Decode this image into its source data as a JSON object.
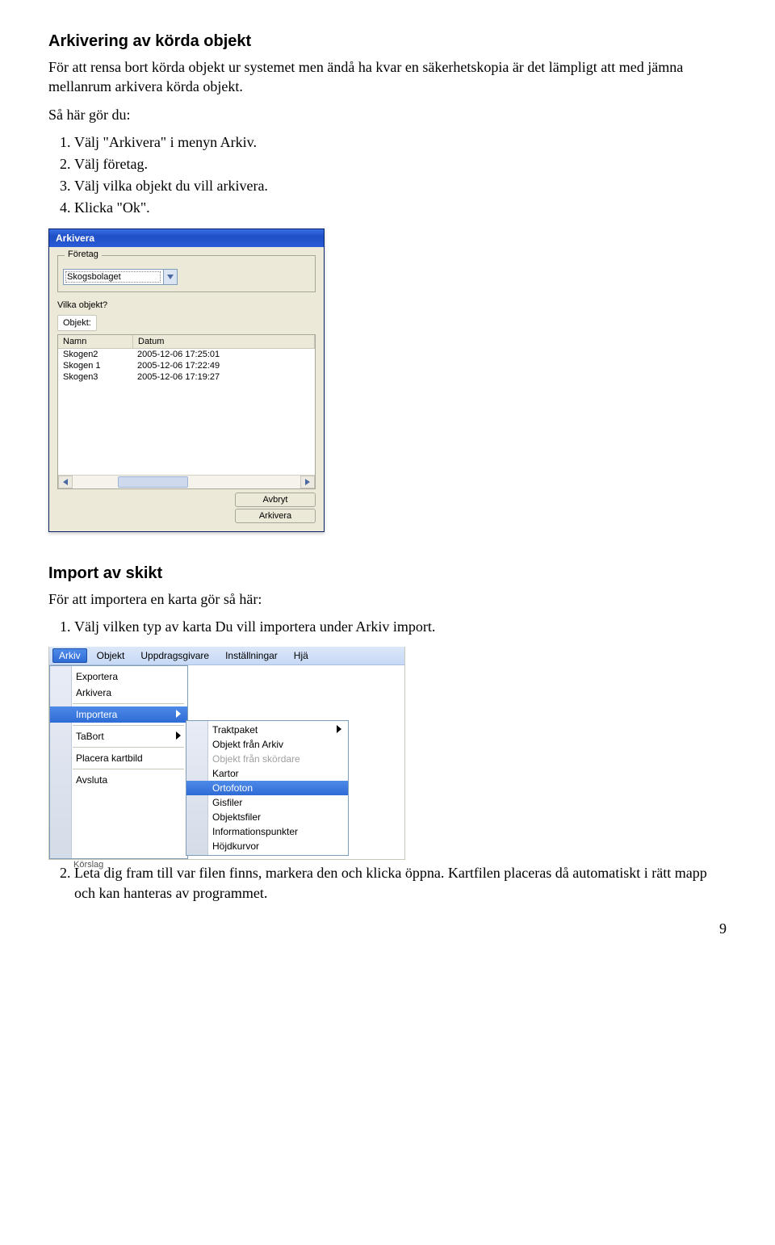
{
  "section1": {
    "heading": "Arkivering av körda objekt",
    "intro": "För att rensa bort körda objekt ur systemet men ändå ha kvar en säkerhetskopia är det lämpligt att med jämna mellanrum arkivera körda objekt.",
    "lead": "Så här gör du:",
    "steps": [
      "Välj \"Arkivera\" i menyn Arkiv.",
      "Välj företag.",
      "Välj vilka objekt du vill arkivera.",
      "Klicka \"Ok\"."
    ]
  },
  "dialog": {
    "title": "Arkivera",
    "group_label": "Företag",
    "company": "Skogsbolaget",
    "question_label": "Vilka objekt?",
    "objects_label": "Objekt:",
    "col_name": "Namn",
    "col_date": "Datum",
    "rows": [
      {
        "name": "Skogen2",
        "date": "2005-12-06 17:25:01"
      },
      {
        "name": "Skogen 1",
        "date": "2005-12-06 17:22:49"
      },
      {
        "name": "Skogen3",
        "date": "2005-12-06 17:19:27"
      }
    ],
    "btn_cancel": "Avbryt",
    "btn_archive": "Arkivera"
  },
  "section2": {
    "heading": "Import av skikt",
    "intro": "För att importera en karta gör så här:",
    "step1": "Välj vilken typ av karta Du vill importera under Arkiv import.",
    "step2": "Leta dig fram till var filen finns, markera den och klicka öppna. Kartfilen placeras då automatiskt i rätt mapp och kan hanteras av programmet."
  },
  "menu": {
    "bar": [
      "Arkiv",
      "Objekt",
      "Uppdragsgivare",
      "Inställningar",
      "Hjä"
    ],
    "dropdown": {
      "items": [
        {
          "label": "Exportera",
          "has_sub": false
        },
        {
          "label": "Arkivera",
          "has_sub": false
        },
        {
          "label": "Importera",
          "has_sub": true,
          "selected": true
        },
        {
          "label": "TaBort",
          "has_sub": true
        },
        {
          "label": "Placera kartbild",
          "has_sub": false
        },
        {
          "label": "Avsluta",
          "has_sub": false
        }
      ]
    },
    "submenu": {
      "items": [
        {
          "label": "Traktpaket",
          "has_sub": true
        },
        {
          "label": "Objekt från Arkiv"
        },
        {
          "label": "Objekt från skördare",
          "disabled": true
        },
        {
          "label": "Kartor"
        },
        {
          "label": "Ortofoton",
          "selected": true
        },
        {
          "label": "Gisfiler"
        },
        {
          "label": "Objektsfiler"
        },
        {
          "label": "Informationspunkter"
        },
        {
          "label": "Höjdkurvor"
        }
      ]
    },
    "bg_item": "Körslag"
  },
  "page_number": "9"
}
